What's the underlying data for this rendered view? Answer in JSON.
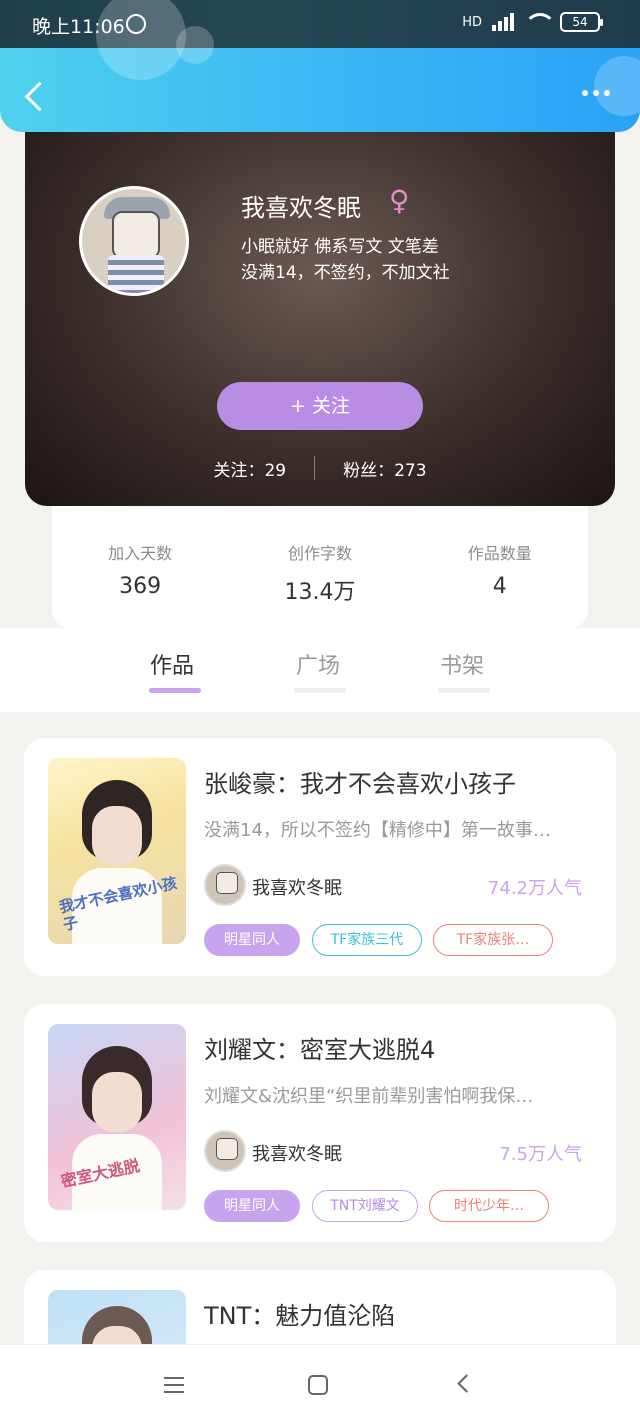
{
  "status_bar": {
    "time": "晚上11:06",
    "network": "HD",
    "battery": "54"
  },
  "profile": {
    "name": "我喜欢冬眠",
    "gender_symbol": "♀",
    "bio_line1": "小眠就好 佛系写文 文笔差",
    "bio_line2": "没满14，不签约，不加文社",
    "follow_button": "+  关注",
    "following_label": "关注：29",
    "followers_label": "粉丝：273"
  },
  "stats": [
    {
      "label": "加入天数",
      "value": "369"
    },
    {
      "label": "创作字数",
      "value": "13.4万"
    },
    {
      "label": "作品数量",
      "value": "4"
    }
  ],
  "tabs": [
    {
      "label": "作品",
      "active": true
    },
    {
      "label": "广场",
      "active": false
    },
    {
      "label": "书架",
      "active": false
    }
  ],
  "books": [
    {
      "title": "张峻豪：我才不会喜欢小孩子",
      "desc": "没满14，所以不签约【精修中】第一故事…",
      "author": "我喜欢冬眠",
      "popularity": "74.2万人气",
      "tags": [
        "明星同人",
        "TF家族三代",
        "TF家族张…"
      ],
      "cover_text": "我才不会喜欢小孩子"
    },
    {
      "title": "刘耀文：密室大逃脱4",
      "desc": "刘耀文&沈织里“织里前辈别害怕啊我保…",
      "author": "我喜欢冬眠",
      "popularity": "7.5万人气",
      "tags": [
        "明星同人",
        "TNT刘耀文",
        "时代少年…"
      ],
      "cover_text": "密室大逃脱"
    },
    {
      "title": "TNT：魅力值沦陷"
    }
  ]
}
